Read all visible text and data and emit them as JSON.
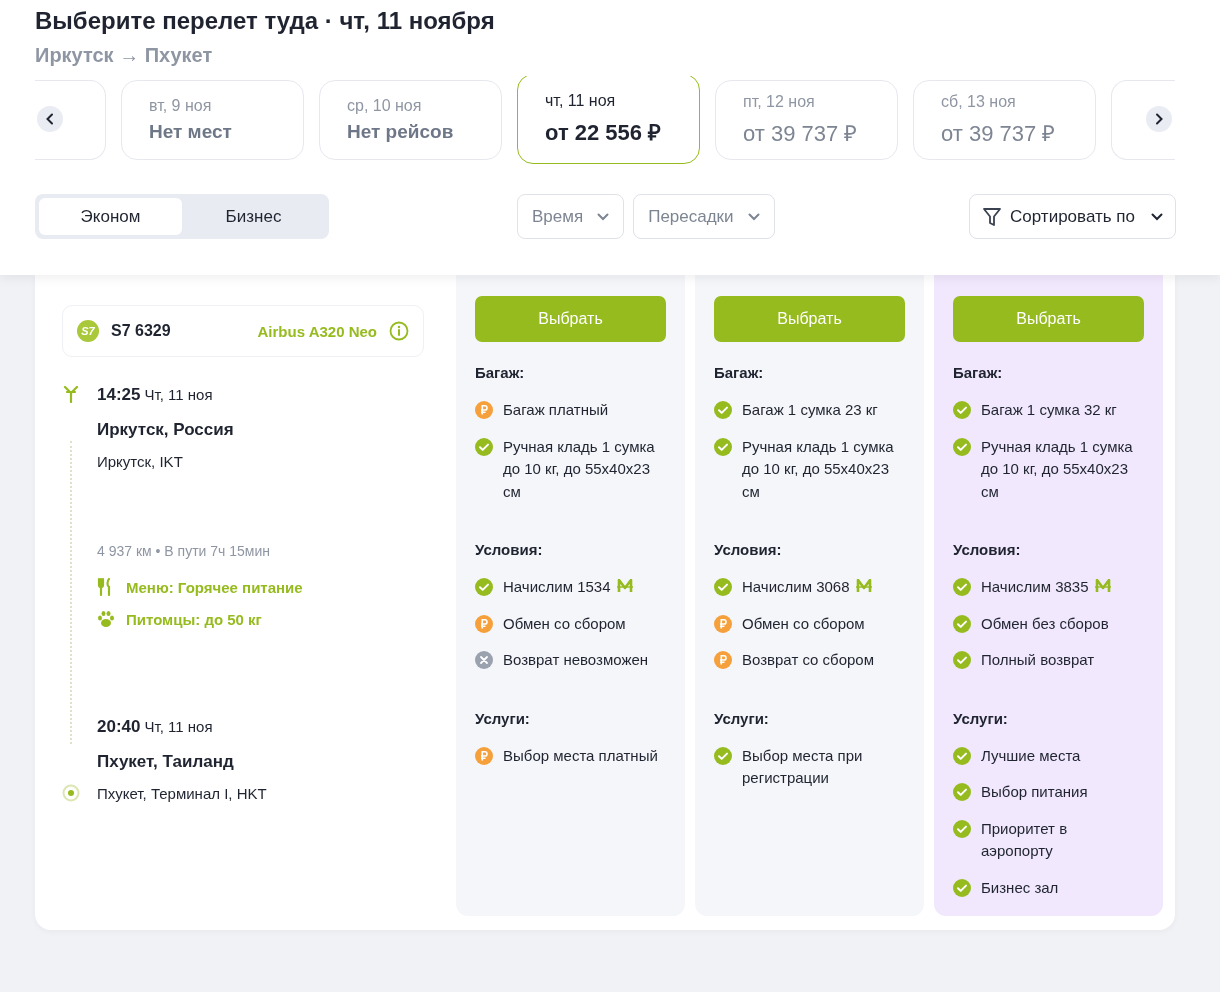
{
  "heading": {
    "title": "Выберите перелет туда · чт, 11 ноября",
    "route": "Иркутск → Пхукет"
  },
  "dates": [
    {
      "day": "вт, 9 ноя",
      "price": "Нет мест",
      "available": false,
      "selected": false
    },
    {
      "day": "ср, 10 ноя",
      "price": "Нет рейсов",
      "available": false,
      "selected": false
    },
    {
      "day": "чт, 11 ноя",
      "price": "от 22 556 ₽",
      "available": true,
      "selected": true
    },
    {
      "day": "пт, 12 ноя",
      "price": "от 39 737 ₽",
      "available": true,
      "selected": false
    },
    {
      "day": "сб, 13 ноя",
      "price": "от 39 737 ₽",
      "available": true,
      "selected": false
    }
  ],
  "fare_classes": [
    {
      "label": "Эконом",
      "selected": true
    },
    {
      "label": "Бизнес",
      "selected": false
    }
  ],
  "filters": [
    {
      "label": "Время"
    },
    {
      "label": "Пересадки"
    }
  ],
  "sort": {
    "label": "Сортировать по"
  },
  "flight": {
    "airline_logo": "S7",
    "number": "S7 6329",
    "aircraft": "Airbus A320 Neo",
    "departure": {
      "time": "14:25",
      "date": "Чт, 11 ноя",
      "city": "Иркутск, Россия",
      "airport": "Иркутск, IKT"
    },
    "stats": "4 937 км • В пути 7ч 15мин",
    "amenities": [
      {
        "kind": "meal",
        "text": "Меню: Горячее питание"
      },
      {
        "kind": "pets",
        "text": "Питомцы: до 50 кг"
      }
    ],
    "arrival": {
      "time": "20:40",
      "date": "Чт, 11 ноя",
      "city": "Пхукет, Таиланд",
      "airport": "Пхукет, Терминал I, HKT"
    }
  },
  "fares": [
    {
      "highlighted": false,
      "button": "Выбрать",
      "sections": [
        {
          "title": "Багаж:",
          "items": [
            {
              "kind": "paid",
              "text": "Багаж платный"
            },
            {
              "kind": "included",
              "text": "Ручная кладь 1 сумка до 10 кг, до 55x40x23 см"
            }
          ]
        },
        {
          "title": "Условия:",
          "items": [
            {
              "kind": "included",
              "text": "Начислим 1534",
              "miles": true
            },
            {
              "kind": "paid",
              "text": "Обмен со сбором"
            },
            {
              "kind": "unavailable",
              "text": "Возврат невозможен"
            }
          ]
        },
        {
          "title": "Услуги:",
          "items": [
            {
              "kind": "paid",
              "text": "Выбор места платный"
            }
          ]
        }
      ]
    },
    {
      "highlighted": false,
      "button": "Выбрать",
      "sections": [
        {
          "title": "Багаж:",
          "items": [
            {
              "kind": "included",
              "text": "Багаж 1 сумка 23 кг"
            },
            {
              "kind": "included",
              "text": "Ручная кладь 1 сумка до 10 кг, до 55x40x23 см"
            }
          ]
        },
        {
          "title": "Условия:",
          "items": [
            {
              "kind": "included",
              "text": "Начислим 3068",
              "miles": true
            },
            {
              "kind": "paid",
              "text": "Обмен со сбором"
            },
            {
              "kind": "paid",
              "text": "Возврат со сбором"
            }
          ]
        },
        {
          "title": "Услуги:",
          "items": [
            {
              "kind": "included",
              "text": "Выбор места при регистрации"
            }
          ]
        }
      ]
    },
    {
      "highlighted": true,
      "button": "Выбрать",
      "sections": [
        {
          "title": "Багаж:",
          "items": [
            {
              "kind": "included",
              "text": "Багаж 1 сумка 32 кг"
            },
            {
              "kind": "included",
              "text": "Ручная кладь 1 сумка до 10 кг, до 55x40x23 см"
            }
          ]
        },
        {
          "title": "Условия:",
          "items": [
            {
              "kind": "included",
              "text": "Начислим 3835",
              "miles": true
            },
            {
              "kind": "included",
              "text": "Обмен без сборов"
            },
            {
              "kind": "included",
              "text": "Полный возврат"
            }
          ]
        },
        {
          "title": "Услуги:",
          "items": [
            {
              "kind": "included",
              "text": "Лучшие места"
            },
            {
              "kind": "included",
              "text": "Выбор питания"
            },
            {
              "kind": "included",
              "text": "Приоритет в аэропорту"
            },
            {
              "kind": "included",
              "text": "Бизнес зал"
            }
          ]
        }
      ]
    }
  ]
}
